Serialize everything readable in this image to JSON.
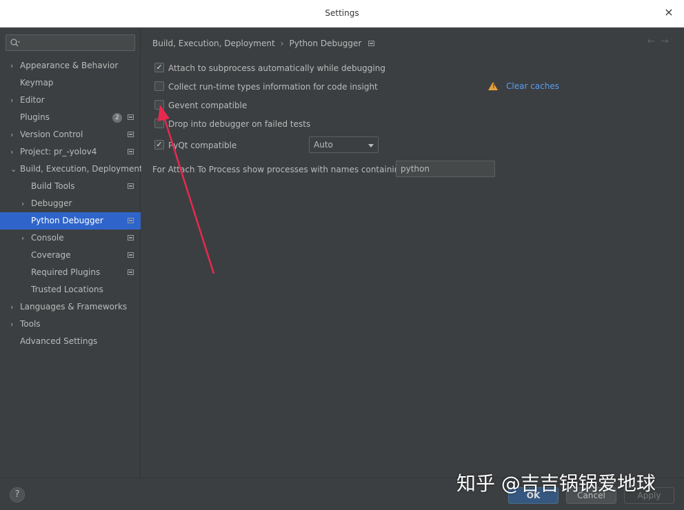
{
  "window": {
    "title": "Settings",
    "close_icon": "×"
  },
  "sidebar": {
    "search": {
      "value": "",
      "placeholder": ""
    },
    "items": [
      {
        "label": "Appearance & Behavior",
        "arrow": "›",
        "level": 0
      },
      {
        "label": "Keymap",
        "level": 0
      },
      {
        "label": "Editor",
        "arrow": "›",
        "level": 0
      },
      {
        "label": "Plugins",
        "level": 0,
        "badge": "2",
        "proj": true
      },
      {
        "label": "Version Control",
        "arrow": "›",
        "level": 0,
        "proj": true
      },
      {
        "label": "Project: pr_-yolov4",
        "arrow": "›",
        "level": 0,
        "proj": true
      },
      {
        "label": "Build, Execution, Deployment",
        "arrow": "⌄",
        "level": 0
      },
      {
        "label": "Build Tools",
        "level": 1,
        "proj": true
      },
      {
        "label": "Debugger",
        "arrow": "›",
        "level": 1
      },
      {
        "label": "Python Debugger",
        "level": 1,
        "proj": true,
        "selected": true
      },
      {
        "label": "Console",
        "arrow": "›",
        "level": 1,
        "proj": true
      },
      {
        "label": "Coverage",
        "level": 1,
        "proj": true
      },
      {
        "label": "Required Plugins",
        "level": 1,
        "proj": true
      },
      {
        "label": "Trusted Locations",
        "level": 1
      },
      {
        "label": "Languages & Frameworks",
        "arrow": "›",
        "level": 0
      },
      {
        "label": "Tools",
        "arrow": "›",
        "level": 0
      },
      {
        "label": "Advanced Settings",
        "level": 0
      }
    ]
  },
  "breadcrumb": {
    "parent": "Build, Execution, Deployment",
    "separator": "›",
    "current": "Python Debugger",
    "back": "←",
    "forward": "→"
  },
  "options": {
    "attach_subprocess": {
      "label": "Attach to subprocess automatically while debugging",
      "checked": true
    },
    "collect_types": {
      "label": "Collect run-time types information for code insight",
      "checked": false
    },
    "gevent": {
      "label": "Gevent compatible",
      "checked": false
    },
    "drop_into_debugger": {
      "label": "Drop into debugger on failed tests",
      "checked": false
    },
    "pyqt": {
      "label": "PyQt compatible",
      "checked": true
    },
    "check_mark": "✓"
  },
  "clear_caches": {
    "label": "Clear caches",
    "warn_mark": "!"
  },
  "pyqt_select": {
    "value": "Auto"
  },
  "attach_process": {
    "label": "For Attach To Process show processes with names containing:",
    "value": "python"
  },
  "footer": {
    "help": "?",
    "ok": "OK",
    "cancel": "Cancel",
    "apply": "Apply"
  },
  "watermark": "知乎 @吉吉锅锅爱地球",
  "colors": {
    "selection": "#2f65ca",
    "link": "#589df6",
    "warning": "#e6a23c",
    "annotation_arrow": "#e8294f",
    "ok_button": "#365880"
  }
}
